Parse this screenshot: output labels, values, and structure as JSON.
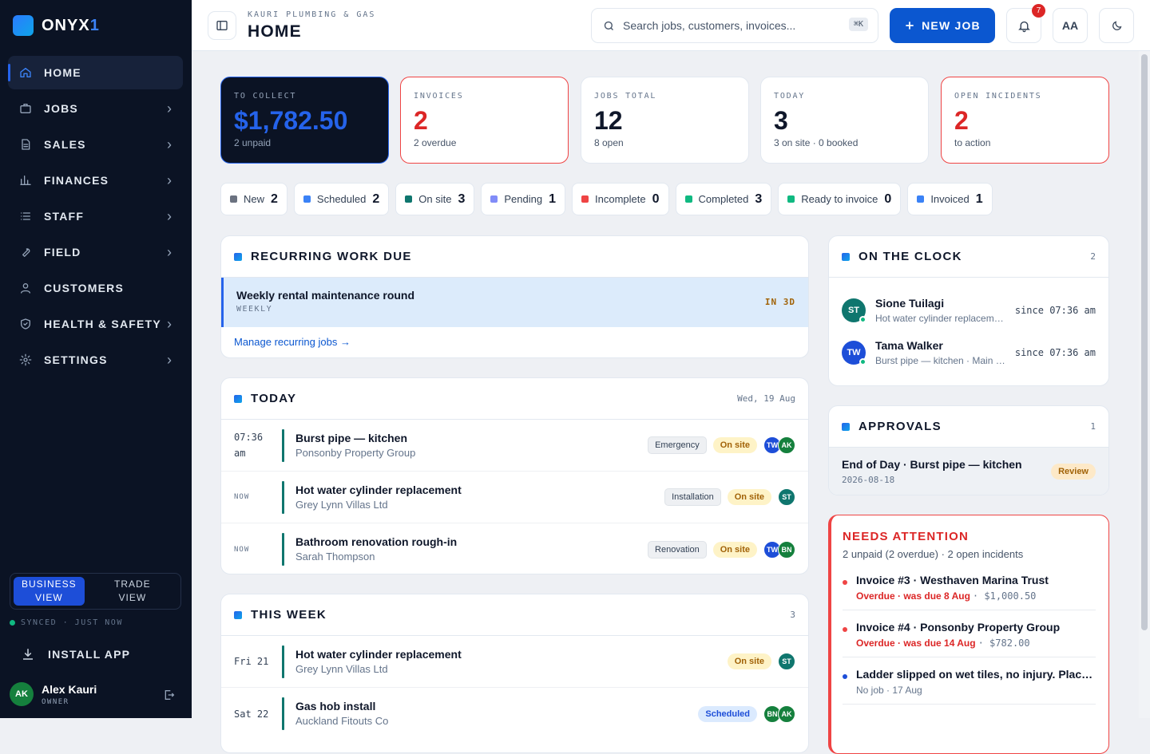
{
  "brand": {
    "name": "ONYX",
    "suffix": "1"
  },
  "nav": [
    {
      "label": "HOME",
      "icon": "home-icon",
      "active": true,
      "chevron": false
    },
    {
      "label": "JOBS",
      "icon": "briefcase-icon",
      "chevron": true
    },
    {
      "label": "SALES",
      "icon": "document-icon",
      "chevron": true
    },
    {
      "label": "FINANCES",
      "icon": "bar-chart-icon",
      "chevron": true
    },
    {
      "label": "STAFF",
      "icon": "list-icon",
      "chevron": true
    },
    {
      "label": "FIELD",
      "icon": "wrench-icon",
      "chevron": true
    },
    {
      "label": "CUSTOMERS",
      "icon": "user-icon",
      "chevron": false
    },
    {
      "label": "HEALTH & SAFETY",
      "icon": "shield-icon",
      "chevron": true
    },
    {
      "label": "SETTINGS",
      "icon": "gear-icon",
      "chevron": true
    }
  ],
  "view_toggle": {
    "business": "BUSINESS VIEW",
    "trade": "TRADE VIEW",
    "active": "business"
  },
  "sync": "SYNCED · JUST NOW",
  "install": "INSTALL APP",
  "user": {
    "initials": "AK",
    "name": "Alex Kauri",
    "role": "OWNER"
  },
  "header": {
    "company": "KAURI PLUMBING & GAS",
    "title": "HOME",
    "search_placeholder": "Search jobs, customers, invoices...",
    "shortcut": "⌘K",
    "new_job": "NEW JOB",
    "notifications": "7",
    "text_size": "AA"
  },
  "stats": [
    {
      "label": "TO COLLECT",
      "value": "$1,782.50",
      "sub": "2 unpaid",
      "style": "dark"
    },
    {
      "label": "INVOICES",
      "value": "2",
      "sub": "2 overdue",
      "style": "alert"
    },
    {
      "label": "JOBS TOTAL",
      "value": "12",
      "sub": "8 open",
      "style": "normal"
    },
    {
      "label": "TODAY",
      "value": "3",
      "sub": "3 on site · 0 booked",
      "style": "normal"
    },
    {
      "label": "OPEN INCIDENTS",
      "value": "2",
      "sub": "to action",
      "style": "alert"
    }
  ],
  "status_chips": [
    {
      "label": "New",
      "count": "2",
      "color": "#6b7280"
    },
    {
      "label": "Scheduled",
      "count": "2",
      "color": "#3b82f6"
    },
    {
      "label": "On site",
      "count": "3",
      "color": "#0f766e"
    },
    {
      "label": "Pending",
      "count": "1",
      "color": "#818cf8"
    },
    {
      "label": "Incomplete",
      "count": "0",
      "color": "#ef4444"
    },
    {
      "label": "Completed",
      "count": "3",
      "color": "#10b981"
    },
    {
      "label": "Ready to invoice",
      "count": "0",
      "color": "#10b981"
    },
    {
      "label": "Invoiced",
      "count": "1",
      "color": "#3b82f6"
    }
  ],
  "recurring": {
    "title": "RECURRING WORK DUE",
    "item": {
      "name": "Weekly rental maintenance round",
      "freq": "WEEKLY",
      "due": "IN 3D"
    },
    "link": "Manage recurring jobs →"
  },
  "today": {
    "title": "TODAY",
    "date": "Wed, 19 Aug",
    "jobs": [
      {
        "time": "07:36 am",
        "title": "Burst pipe — kitchen",
        "customer": "Ponsonby Property Group",
        "tag": "Emergency",
        "status": "On site",
        "avatars": [
          "TW",
          "AK"
        ]
      },
      {
        "time": "NOW",
        "title": "Hot water cylinder replacement",
        "customer": "Grey Lynn Villas Ltd",
        "tag": "Installation",
        "status": "On site",
        "avatars": [
          "ST"
        ]
      },
      {
        "time": "NOW",
        "title": "Bathroom renovation rough-in",
        "customer": "Sarah Thompson",
        "tag": "Renovation",
        "status": "On site",
        "avatars": [
          "TW",
          "BN"
        ]
      }
    ]
  },
  "this_week": {
    "title": "THIS WEEK",
    "count": "3",
    "jobs": [
      {
        "day": "Fri 21",
        "title": "Hot water cylinder replacement",
        "customer": "Grey Lynn Villas Ltd",
        "status": "On site",
        "avatars": [
          "ST"
        ]
      },
      {
        "day": "Sat 22",
        "title": "Gas hob install",
        "customer": "Auckland Fitouts Co",
        "status": "Scheduled",
        "avatars": [
          "BN",
          "AK"
        ]
      }
    ]
  },
  "on_clock": {
    "title": "ON THE CLOCK",
    "count": "2",
    "staff": [
      {
        "initials": "ST",
        "name": "Sione Tuilagi",
        "job": "Hot water cylinder replacement",
        "since": "since 07:36 am"
      },
      {
        "initials": "TW",
        "name": "Tama Walker",
        "job": "Burst pipe — kitchen · Main bathroom",
        "since": "since 07:36 am"
      }
    ]
  },
  "approvals": {
    "title": "APPROVALS",
    "count": "1",
    "item": {
      "title": "End of Day · Burst pipe — kitchen",
      "date": "2026-08-18",
      "badge": "Review"
    }
  },
  "attention": {
    "title": "NEEDS ATTENTION",
    "summary": "2 unpaid (2 overdue) · 2 open incidents",
    "items": [
      {
        "title": "Invoice #3 · Westhaven Marina Trust",
        "overdue": "Overdue · was due 8 Aug",
        "amount": "· $1,000.50",
        "dot": "#ef4444"
      },
      {
        "title": "Invoice #4 · Ponsonby Property Group",
        "overdue": "Overdue · was due 14 Aug",
        "amount": "· $782.00",
        "dot": "#ef4444"
      },
      {
        "title": "Ladder slipped on wet tiles, no injury. Placed cones",
        "note": "No job · 17 Aug",
        "dot": "#1d4ed8"
      }
    ]
  }
}
